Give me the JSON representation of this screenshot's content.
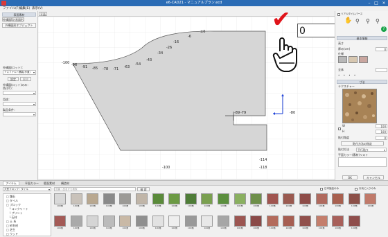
{
  "window": {
    "title": "e6-CAD21 - マニュアルプラン.ecd"
  },
  "menu": [
    "ファイル(F)",
    "編集(E)",
    "表示(V)",
    "表示"
  ],
  "mode_tab": "平面",
  "left_panel": {
    "header": "表面素材",
    "tabs": [
      "外構図",
      "計画図形"
    ],
    "button_top": "外構図形オブジェクト",
    "material_label": "外構図(ロット)：",
    "material_value": "アスファルト舗装(歩道)",
    "btn_set": "設定",
    "btn_clear": "解除",
    "color_label": "外構図(ロット)のみ：",
    "color_label2": "色(DT)：",
    "usage_label": "用途：",
    "search_label": "製品条件："
  },
  "right_panel": {
    "checkbox_label": "リアルタイムパース",
    "header_main": "基本情報",
    "label_height": "高さ",
    "label_thickness": "厚み(cm)",
    "label_size": "仕様",
    "value_height": "0",
    "label_angle": "全体",
    "section_header": "寸法",
    "texture_label": "テクスチャー",
    "val_w": "100",
    "val_h": "100",
    "label_rotation": "貼付角度",
    "val_rotation": "0",
    "btn_apply": "貼付方法の指定",
    "label_method": "貼付方法",
    "val_method": "平行貼り",
    "section_footer": "平面カラー(素材)リスト",
    "btn_ok": "OK",
    "btn_cancel": "キャンセル"
  },
  "overlay": {
    "input_value": "0",
    "checkmark": "✔"
  },
  "drawing": {
    "top_labels": [
      "±0",
      "-6",
      "-16",
      "-26",
      "-34",
      "-43",
      "-54",
      "-63",
      "-71",
      "-78",
      "-85",
      "-91",
      "-96",
      "-100"
    ],
    "right_labels": [
      "-79",
      "-80",
      "-89"
    ],
    "bottom_labels": [
      "-100",
      "-114",
      "-118"
    ]
  },
  "bottom": {
    "tabs": [
      "アイテム",
      "平面カラー",
      "壁面素材",
      "構造材"
    ],
    "search_placeholder": "品番・品名から検索",
    "dropdown_value": "大型ブロック・タイル",
    "search_button": "検 索",
    "checkbox1": "日本製品のみ",
    "checkbox2": "お気に入りのみ",
    "tree_items": [
      "□ 舗石",
      "□ タイル",
      "□ ブロック",
      "└ コンクリート",
      "└ プリント",
      "└ 石材",
      "□ 土 系",
      "□ 砂利材",
      "□ 芝生",
      "□ ウッド"
    ],
    "swatches": [
      {
        "label": "100角",
        "color": "#d9d9d9"
      },
      {
        "label": "100角",
        "color": "#c9c2ba"
      },
      {
        "label": "100角",
        "color": "#b9a890"
      },
      {
        "label": "100角",
        "color": "#8a8a8a"
      },
      {
        "label": "100角",
        "color": "#9c9a96"
      },
      {
        "label": "100角",
        "color": "#c0b5a8"
      },
      {
        "label": "100角",
        "color": "#5a8a3a"
      },
      {
        "label": "100角",
        "color": "#6c9a44"
      },
      {
        "label": "100角",
        "color": "#4f7d38"
      },
      {
        "label": "100角",
        "color": "#7aa050"
      },
      {
        "label": "100角",
        "color": "#5b8f3e"
      },
      {
        "label": "100角",
        "color": "#8ab060"
      },
      {
        "label": "100角",
        "color": "#6e8f4a"
      },
      {
        "label": "100角",
        "color": "#a05550"
      },
      {
        "label": "100角",
        "color": "#9a5a50"
      },
      {
        "label": "100角",
        "color": "#8e4c48"
      },
      {
        "label": "100角",
        "color": "#b06a5e"
      },
      {
        "label": "100角",
        "color": "#a8604f"
      },
      {
        "label": "100角",
        "color": "#8c5048"
      },
      {
        "label": "100角",
        "color": "#c07a6a"
      },
      {
        "label": "100角",
        "color": "#a35a56"
      },
      {
        "label": "100角",
        "color": "#aaaaaa"
      },
      {
        "label": "100角",
        "color": "#d5d5d5"
      },
      {
        "label": "100角",
        "color": "#bbbbbb"
      },
      {
        "label": "100角",
        "color": "#c9b9a6"
      },
      {
        "label": "100角",
        "color": "#8f8f8f"
      },
      {
        "label": "100角",
        "color": "#e2e2e2"
      },
      {
        "label": "100角",
        "color": "#eeeeee"
      },
      {
        "label": "100角",
        "color": "#999999"
      },
      {
        "label": "100角",
        "color": "#e8e8e8"
      },
      {
        "label": "100角",
        "color": "#a6a6a6"
      },
      {
        "label": "100角",
        "color": "#9c5652"
      },
      {
        "label": "100角",
        "color": "#8a4a48"
      },
      {
        "label": "100角",
        "color": "#b36b5c"
      },
      {
        "label": "100角",
        "color": "#a65e52"
      },
      {
        "label": "100角",
        "color": "#91504c"
      },
      {
        "label": "100角",
        "color": "#c47e6c"
      },
      {
        "label": "100角",
        "color": "#a8605a"
      },
      {
        "label": "100角",
        "color": "#8f4e4c"
      }
    ]
  }
}
